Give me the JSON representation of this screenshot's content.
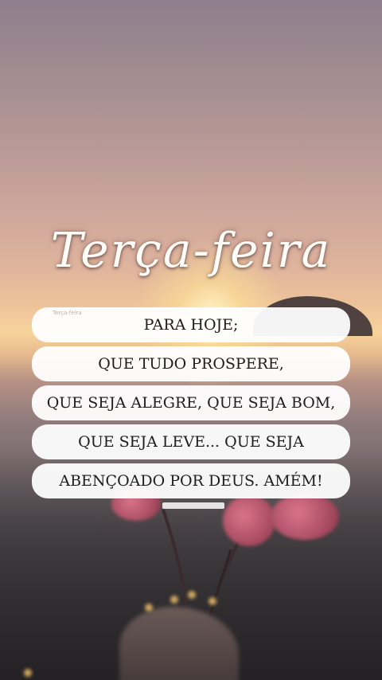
{
  "title": "Terça-feira",
  "watermark": "Terça-feira",
  "message_lines": [
    "PARA HOJE;",
    "QUE TUDO PROSPERE,",
    "QUE SEJA ALEGRE, QUE SEJA BOM,",
    "QUE SEJA LEVE... QUE SEJA",
    "ABENÇOADO POR DEUS. AMÉM!"
  ],
  "scene": {
    "description_icons": [
      "sunset-sky",
      "sun-glow",
      "island",
      "pink-flowers",
      "hand-holding-flowers"
    ],
    "accent_colors": {
      "sky_top": "#8d7f8c",
      "sun": "#f6d39a",
      "petal": "#c05a72",
      "text_box": "#ffffff"
    }
  }
}
